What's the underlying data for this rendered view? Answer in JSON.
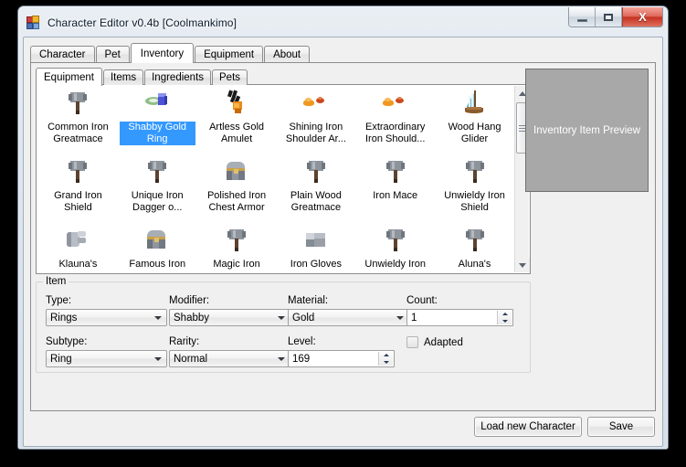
{
  "window": {
    "title": "Character Editor v0.4b [Coolmankimo]",
    "icon": "app-squares-icon",
    "controls": {
      "minimize": "minimize-icon",
      "maximize": "maximize-icon",
      "close": "close-icon",
      "close_glyph": "X"
    }
  },
  "outer_tabs": [
    {
      "label": "Character",
      "selected": false
    },
    {
      "label": "Pet",
      "selected": false
    },
    {
      "label": "Inventory",
      "selected": true
    },
    {
      "label": "Equipment",
      "selected": false
    },
    {
      "label": "About",
      "selected": false
    }
  ],
  "inner_tabs": [
    {
      "label": "Equipment",
      "selected": true
    },
    {
      "label": "Items",
      "selected": false
    },
    {
      "label": "Ingredients",
      "selected": false
    },
    {
      "label": "Pets",
      "selected": false
    }
  ],
  "inventory_grid": {
    "rows": [
      [
        {
          "label": "Common Iron\nGreatmace",
          "icon": "mace-icon",
          "selected": false
        },
        {
          "label": "Shabby Gold\nRing",
          "icon": "ring-icon",
          "selected": true
        },
        {
          "label": "Artless Gold\nAmulet",
          "icon": "amulet-icon",
          "selected": false
        },
        {
          "label": "Shining Iron\nShoulder Ar...",
          "icon": "shoulder-icon",
          "selected": false
        },
        {
          "label": "Extraordinary\nIron Should...",
          "icon": "shoulder-icon",
          "selected": false
        },
        {
          "label": "Wood Hang\nGlider",
          "icon": "glider-icon",
          "selected": false
        }
      ],
      [
        {
          "label": "Grand Iron\nShield",
          "icon": "mace-icon",
          "selected": false
        },
        {
          "label": "Unique Iron\nDagger o...",
          "icon": "mace-icon",
          "selected": false
        },
        {
          "label": "Polished Iron\nChest Armor",
          "icon": "chest-icon",
          "selected": false
        },
        {
          "label": "Plain Wood\nGreatmace",
          "icon": "mace-icon",
          "selected": false
        },
        {
          "label": "Iron Mace",
          "icon": "mace-icon",
          "selected": false
        },
        {
          "label": "Unwieldy Iron\nShield",
          "icon": "mace-icon",
          "selected": false
        }
      ],
      [
        {
          "label": "Klauna's",
          "icon": "gloves-icon",
          "selected": false
        },
        {
          "label": "Famous Iron",
          "icon": "chest-icon",
          "selected": false
        },
        {
          "label": "Magic Iron",
          "icon": "mace-icon",
          "selected": false
        },
        {
          "label": "Iron Gloves",
          "icon": "block-icon",
          "selected": false
        },
        {
          "label": "Unwieldy Iron",
          "icon": "mace-icon",
          "selected": false
        },
        {
          "label": "Aluna's",
          "icon": "mace-icon",
          "selected": false
        }
      ]
    ]
  },
  "scrollbar": {
    "up_arrow": "scroll-up-icon",
    "down_arrow": "scroll-down-icon",
    "thumb": "scroll-thumb"
  },
  "preview": {
    "label": "Inventory Item Preview"
  },
  "item_group": {
    "title": "Item",
    "fields": {
      "type": {
        "label": "Type:",
        "value": "Rings"
      },
      "modifier": {
        "label": "Modifier:",
        "value": "Shabby"
      },
      "material": {
        "label": "Material:",
        "value": "Gold"
      },
      "count": {
        "label": "Count:",
        "value": "1"
      },
      "subtype": {
        "label": "Subtype:",
        "value": "Ring"
      },
      "rarity": {
        "label": "Rarity:",
        "value": "Normal"
      },
      "level": {
        "label": "Level:",
        "value": "169"
      },
      "adapted": {
        "label": "Adapted",
        "checked": false
      }
    }
  },
  "bottom_buttons": {
    "load": "Load new Character",
    "save": "Save"
  },
  "colors": {
    "selection_blue": "#3399ff",
    "preview_gray": "#a8a8a8",
    "close_red": "#c53322",
    "client_bg": "#f0f0f0"
  }
}
